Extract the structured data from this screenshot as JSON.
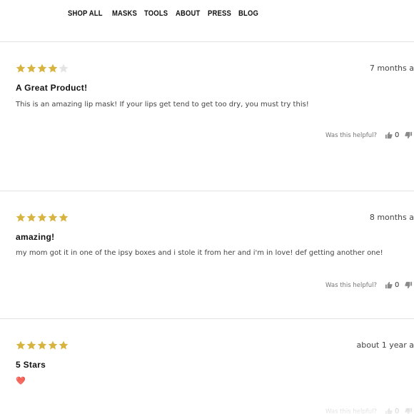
{
  "nav": {
    "items": [
      "SHOP ALL",
      "MASKS",
      "TOOLS",
      "ABOUT",
      "PRESS",
      "BLOG"
    ]
  },
  "colors": {
    "star_filled": "#d7b33f",
    "star_empty": "#e4e4e4"
  },
  "reviews": [
    {
      "rating": 4,
      "max_rating": 5,
      "date": "7 months a",
      "title": "A Great Product!",
      "body": "This is an amazing lip mask! If your lips get tend to get too dry, you must try this!",
      "helpful_label": "Was this helpful?",
      "up_count": "0",
      "icons": {
        "up": "thumbs-up-icon",
        "down": "thumbs-down-icon"
      }
    },
    {
      "rating": 5,
      "max_rating": 5,
      "date": "8 months a",
      "title": "amazing!",
      "body": "my mom got it in one of the ipsy boxes and i stole it from her and i'm in love! def getting another one!",
      "helpful_label": "Was this helpful?",
      "up_count": "0",
      "icons": {
        "up": "thumbs-up-icon",
        "down": "thumbs-down-icon"
      }
    },
    {
      "rating": 5,
      "max_rating": 5,
      "date": "about 1 year a",
      "title": "5 Stars",
      "body": "❤️",
      "helpful_label": "Was this helpful?",
      "up_count": "0",
      "icons": {
        "up": "thumbs-up-icon",
        "down": "thumbs-down-icon"
      }
    }
  ]
}
